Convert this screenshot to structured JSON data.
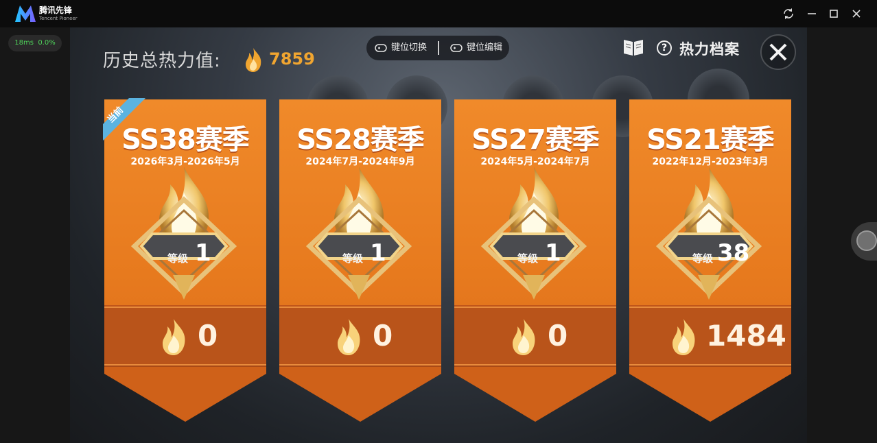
{
  "app": {
    "name": "腾讯先锋",
    "subtitle": "Tencent Pioneer"
  },
  "perf": {
    "ping": "18ms",
    "loss": "0.0%"
  },
  "history": {
    "label": "历史总热力值:",
    "value": "7859"
  },
  "keybar": {
    "switch_label": "键位切换",
    "edit_label": "键位编辑"
  },
  "header": {
    "archive_label": "热力档案",
    "help_icon": "?"
  },
  "level_label": "等级",
  "current_tag": "当前",
  "seasons": [
    {
      "title": "SS38赛季",
      "dates": "2026年3月-2026年5月",
      "level": "1",
      "heat": "0",
      "current": true
    },
    {
      "title": "SS28赛季",
      "dates": "2024年7月-2024年9月",
      "level": "1",
      "heat": "0",
      "current": false
    },
    {
      "title": "SS27赛季",
      "dates": "2024年5月-2024年7月",
      "level": "1",
      "heat": "0",
      "current": false
    },
    {
      "title": "SS21赛季",
      "dates": "2022年12月-2023年3月",
      "level": "38",
      "heat": "1484",
      "current": false
    }
  ],
  "colors": {
    "card": "#e8781f",
    "heat": "#f0a530"
  }
}
